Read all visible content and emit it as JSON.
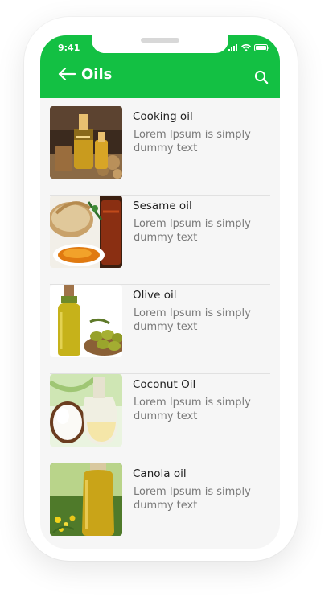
{
  "status_bar": {
    "time": "9:41"
  },
  "header": {
    "title": "Oils"
  },
  "colors": {
    "accent": "#13c043",
    "background": "#f6f6f6"
  },
  "icons": {
    "back": "left-arrow-icon",
    "search": "search-icon",
    "signal": "cellular-signal-icon",
    "wifi": "wifi-icon",
    "battery": "battery-icon"
  },
  "items": [
    {
      "name": "Cooking oil",
      "description": "Lorem Ipsum is simply dummy text"
    },
    {
      "name": "Sesame oil",
      "description": "Lorem Ipsum is simply dummy text"
    },
    {
      "name": "Olive oil",
      "description": "Lorem Ipsum is simply dummy text"
    },
    {
      "name": "Coconut Oil",
      "description": "Lorem Ipsum is simply dummy text"
    },
    {
      "name": "Canola oil",
      "description": "Lorem Ipsum is simply dummy text"
    }
  ]
}
